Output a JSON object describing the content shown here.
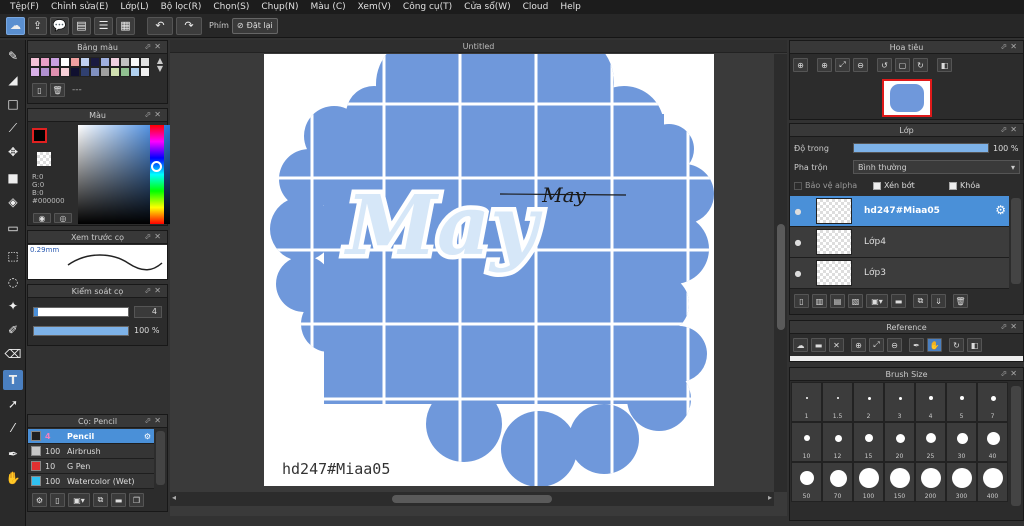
{
  "menu": [
    "Tệp(F)",
    "Chỉnh sửa(E)",
    "Lớp(L)",
    "Bộ lọc(R)",
    "Chọn(S)",
    "Chụp(N)",
    "Màu (C)",
    "Xem(V)",
    "Công cụ(T)",
    "Cửa sổ(W)",
    "Cloud",
    "Help"
  ],
  "toolbar": {
    "key_label": "Phím",
    "reset_label": "Đặt lại"
  },
  "palette": {
    "title": "Bảng màu",
    "extra_label": "---",
    "swatches": [
      "#f4c2d8",
      "#e8a0c8",
      "#c9a0e0",
      "#ffffff",
      "#f0a0a0",
      "#c0d0f0",
      "#1a1a40",
      "#a0b0e0",
      "#f0d0e0",
      "#c0c0c0",
      "#f8f8f8",
      "#e0e0e0",
      "#d8b0e8",
      "#b090d0",
      "#e090b0",
      "#f8d0d8",
      "#101030",
      "#304070",
      "#8090c0",
      "#a0a0a0",
      "#d0e0b0",
      "#90c090",
      "#b0d0f0",
      "#f0f0f0"
    ]
  },
  "color": {
    "title": "Màu",
    "r": "R:0",
    "g": "G:0",
    "b": "B:0",
    "hex": "#000000"
  },
  "brush_preview": {
    "title": "Xem trước cọ",
    "size": "0.29mm"
  },
  "brush_control": {
    "title": "Kiểm soát cọ",
    "size_value": "4",
    "opacity_value": "100 %",
    "opacity_frac": 1.0
  },
  "brush_list": {
    "title": "Cọ: Pencil",
    "items": [
      {
        "size": "4",
        "name": "Pencil",
        "color": "#202020",
        "active": true
      },
      {
        "size": "100",
        "name": "Airbrush",
        "color": "#c8c8c8",
        "active": false
      },
      {
        "size": "10",
        "name": "G Pen",
        "color": "#e03030",
        "active": false
      },
      {
        "size": "100",
        "name": "Watercolor (Wet)",
        "color": "#30c0f0",
        "active": false
      }
    ]
  },
  "canvas": {
    "tab": "Untitled",
    "watermark": "hd247#Miaa05",
    "title_text": "May",
    "script_text": "May",
    "colors": {
      "blue": "#6f98db",
      "lightblue": "#d6e7f8"
    }
  },
  "navigator": {
    "title": "Hoa tiêu"
  },
  "layer": {
    "title": "Lớp",
    "opacity_label": "Độ trong",
    "opacity_value": "100 %",
    "opacity_frac": 1.0,
    "blend_label": "Pha trộn",
    "blend_value": "Bình thường",
    "protect_alpha": "Bảo vệ alpha",
    "clipping": "Xén bớt",
    "lock": "Khóa",
    "layers": [
      {
        "name": "hd247#Miaa05",
        "active": true
      },
      {
        "name": "Lớp4",
        "active": false
      },
      {
        "name": "Lớp3",
        "active": false
      }
    ]
  },
  "reference": {
    "title": "Reference"
  },
  "brush_size": {
    "title": "Brush Size",
    "sizes": [
      "1",
      "1.5",
      "2",
      "3",
      "4",
      "5",
      "7",
      "10",
      "12",
      "15",
      "20",
      "25",
      "30",
      "40",
      "50",
      "70",
      "100",
      "150",
      "200",
      "300",
      "400"
    ]
  }
}
